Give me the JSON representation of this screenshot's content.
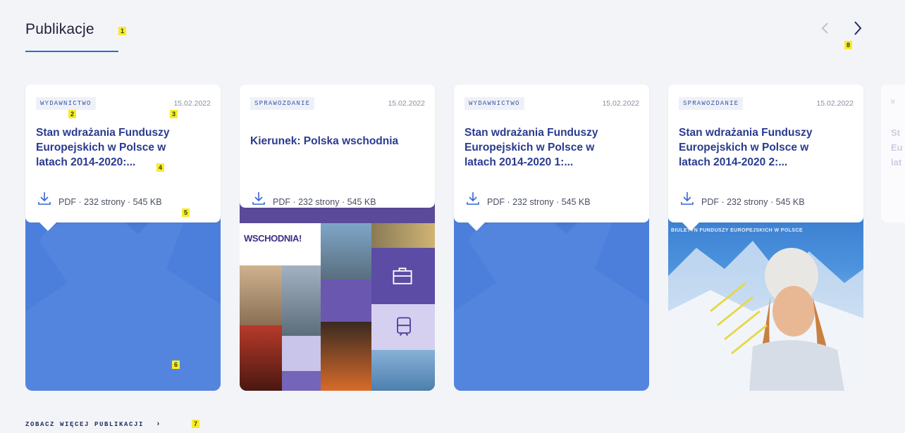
{
  "header": {
    "title": "Publikacje"
  },
  "markers": {
    "m1": "1",
    "m2": "2",
    "m3": "3",
    "m4": "4",
    "m5": "5",
    "m6": "6",
    "m7": "7",
    "m8": "8"
  },
  "nav": {
    "prev_icon": "chevron-left-icon",
    "next_icon": "chevron-right-icon"
  },
  "cards": [
    {
      "tag": "WYDAWNICTWO",
      "date": "15.02.2022",
      "title": "Stan wdrażania Funduszy Europejskich w Polsce w latach 2014-2020:...",
      "meta": "PDF · 232 strony · 545 KB",
      "cover": "blue-pattern"
    },
    {
      "tag": "SPRAWOZDANIE",
      "date": "15.02.2022",
      "title": "Kierunek: Polska wschodnia",
      "meta": "PDF · 232 strony · 545 KB",
      "cover": "collage",
      "cover_text": "WSCHODNIA!"
    },
    {
      "tag": "WYDAWNICTWO",
      "date": "15.02.2022",
      "title": "Stan wdrażania Funduszy Europejskich w Polsce w latach 2014-2020 1:...",
      "meta": "PDF · 232 strony · 545 KB",
      "cover": "blue-pattern"
    },
    {
      "tag": "SPRAWOZDANIE",
      "date": "15.02.2022",
      "title": "Stan wdrażania Funduszy Europejskich w Polsce w latach 2014-2020 2:...",
      "meta": "PDF · 232 strony · 545 KB",
      "cover": "photo",
      "cover_text": "BIULETYN FUNDUSZY EUROPEJSKICH W POLSCE"
    }
  ],
  "partial_card": {
    "tag": "W",
    "title": "St Eu lat"
  },
  "footer": {
    "see_more": "ZOBACZ WIĘCEJ PUBLIKACJI"
  },
  "colors": {
    "accent": "#3367d6",
    "card_blue": "#4c7fdb",
    "title": "#2a3b8f",
    "badge": "#f7ec2b"
  }
}
